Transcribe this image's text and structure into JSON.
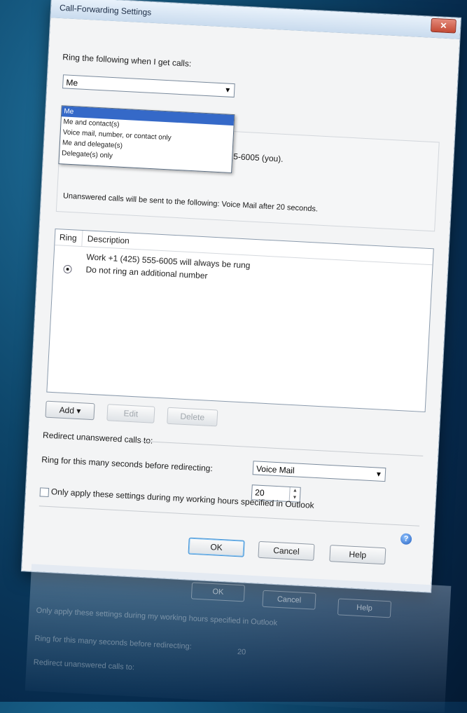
{
  "window": {
    "title": "Call-Forwarding Settings",
    "close_glyph": "✕"
  },
  "ring_section": {
    "label": "Ring the following when I get calls:",
    "selected": "Me",
    "options": [
      "Me",
      "Me and contact(s)",
      "Voice mail, number, or contact only",
      "Me and delegate(s)",
      "Delegate(s) only"
    ],
    "partial_number_text": "5-6005 (you).",
    "unanswered_summary": "Unanswered calls will be sent to the following: Voice Mail after 20 seconds."
  },
  "ring_list": {
    "headers": {
      "ring": "Ring",
      "description": "Description"
    },
    "rows": [
      {
        "text": "Work +1 (425) 555-6005 will always be rung"
      },
      {
        "text": "Do not ring an additional number",
        "radio": true
      }
    ]
  },
  "buttons": {
    "add": "Add",
    "add_arrow": "▾",
    "edit": "Edit",
    "delete": "Delete"
  },
  "redirect": {
    "label": "Redirect unanswered calls to:",
    "target": "Voice Mail",
    "seconds_label": "Ring for this many seconds before redirecting:",
    "seconds": "20",
    "working_hours_label": "Only apply these settings during my working hours specified in Outlook",
    "working_hours_checked": false
  },
  "dialog_buttons": {
    "ok": "OK",
    "cancel": "Cancel",
    "help": "Help"
  },
  "icons": {
    "help": "help-icon",
    "combo_arrow": "chevron-down-icon"
  },
  "reflection": {
    "ok": "OK",
    "cancel": "Cancel",
    "help": "Help",
    "line1": "Only apply these settings during my working hours specified in Outlook",
    "line2": "Ring for this many seconds before redirecting:",
    "line3": "Redirect unanswered calls to:",
    "seconds": "20"
  }
}
